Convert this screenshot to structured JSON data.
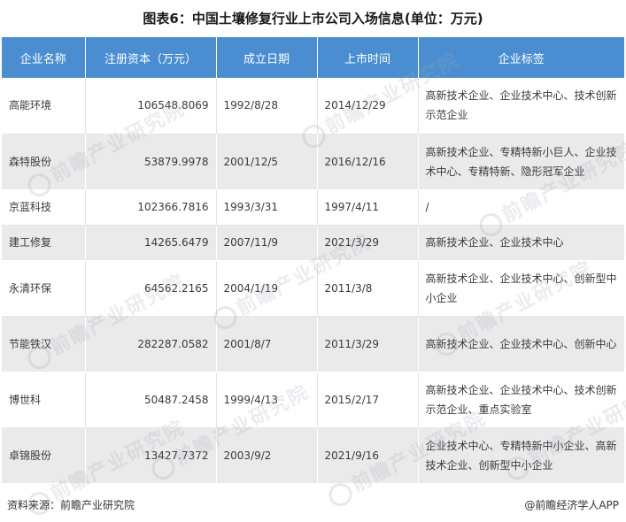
{
  "title": "图表6：中国土壤修复行业上市公司入场信息(单位：万元)",
  "table": {
    "headers": [
      "企业名称",
      "注册资本（万元）",
      "成立日期",
      "上市时间",
      "企业标签"
    ],
    "rows": [
      {
        "name": "高能环境",
        "capital": "106548.8069",
        "founded": "1992/8/28",
        "listed": "2014/12/29",
        "tags": "高新技术企业、企业技术中心、技术创新示范企业"
      },
      {
        "name": "森特股份",
        "capital": "53879.9978",
        "founded": "2001/12/5",
        "listed": "2016/12/16",
        "tags": "高新技术企业、专精特新小巨人、企业技术中心、专精特新、隐形冠军企业"
      },
      {
        "name": "京蓝科技",
        "capital": "102366.7816",
        "founded": "1993/3/31",
        "listed": "1997/4/11",
        "tags": "/"
      },
      {
        "name": "建工修复",
        "capital": "14265.6479",
        "founded": "2007/11/9",
        "listed": "2021/3/29",
        "tags": "高新技术企业、企业技术中心"
      },
      {
        "name": "永清环保",
        "capital": "64562.2165",
        "founded": "2004/1/19",
        "listed": "2011/3/8",
        "tags": "高新技术企业、企业技术中心、创新型中小企业"
      },
      {
        "name": "节能铁汉",
        "capital": "282287.0582",
        "founded": "2001/8/7",
        "listed": "2011/3/29",
        "tags": "高新技术企业、企业技术中心、创新中心"
      },
      {
        "name": "博世科",
        "capital": "50487.2458",
        "founded": "1999/4/13",
        "listed": "2015/2/17",
        "tags": "高新技术企业、企业技术中心、技术创新示范企业、重点实验室"
      },
      {
        "name": "卓锦股份",
        "capital": "13427.7372",
        "founded": "2003/9/2",
        "listed": "2021/9/16",
        "tags": "企业技术中心、专精特新中小企业、高新技术企业、创新型中小企业"
      }
    ]
  },
  "footer": {
    "source": "资料来源：前瞻产业研究院",
    "brand": "@前瞻经济学人APP"
  },
  "watermark": "前瞻产业研究院",
  "colors": {
    "header_bg": "#4a8ed1",
    "row_alt_bg": "#eaeaea"
  }
}
